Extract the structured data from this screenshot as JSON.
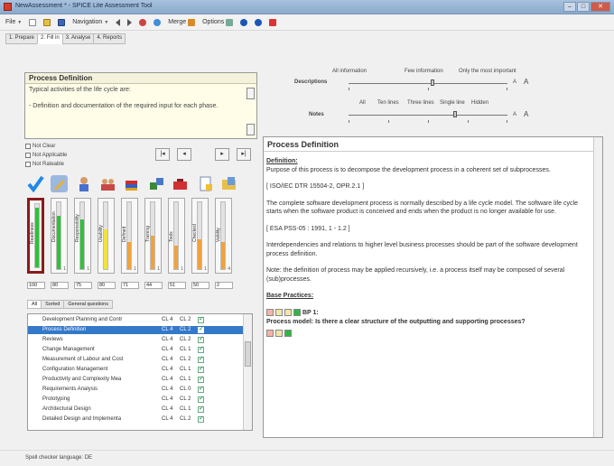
{
  "window": {
    "title": "NewAssessment * - SPICE Lite Assessment Tool",
    "min": "–",
    "max": "□",
    "close": "✕"
  },
  "menu": {
    "file": "File",
    "navigation": "Navigation",
    "merge": "Merge",
    "options": "Options"
  },
  "tabs": [
    "1. Prepare",
    "2. Fill in",
    "3. Analyse",
    "4. Reports"
  ],
  "active_tab": 1,
  "process_header": {
    "title": "Process Definition",
    "text": "Typical activities of the life cycle are:\n\n- Definition and documentation of the required input for each phase."
  },
  "descriptions": {
    "label": "Descriptions",
    "options": [
      "All information",
      "Few information",
      "Only the most important"
    ],
    "font_small": "A",
    "font_big": "A"
  },
  "notes": {
    "label": "Notes",
    "options": [
      "All",
      "Ten lines",
      "Three lines",
      "Single line",
      "Hidden"
    ],
    "font_small": "A",
    "font_big": "A"
  },
  "checkboxes": [
    "Not Clear",
    "Not Applicable",
    "Not Rateable"
  ],
  "nav_buttons": {
    "first": "|◂",
    "prev": "◂",
    "next": "▸",
    "last": "▸|"
  },
  "icons": [
    "check-icon",
    "pencil-icon",
    "person-icon",
    "team-icon",
    "books-icon",
    "tools-icon",
    "toolbox-icon",
    "document-icon",
    "folder-icon"
  ],
  "gauges": [
    {
      "label": "Readiness",
      "fill": 0.95,
      "color": "#2fc23a",
      "num": ""
    },
    {
      "label": "Documentation",
      "fill": 0.8,
      "color": "#2fc23a",
      "num": "1"
    },
    {
      "label": "Responsibility",
      "fill": 0.75,
      "color": "#2fc23a",
      "num": "1"
    },
    {
      "label": "Usability",
      "fill": 0.6,
      "color": "#f2e23a",
      "num": ""
    },
    {
      "label": "Defined",
      "fill": 0.4,
      "color": "#f2a23a",
      "num": "1"
    },
    {
      "label": "Training",
      "fill": 0.5,
      "color": "#f2a23a",
      "num": "1"
    },
    {
      "label": "Tools",
      "fill": 0.35,
      "color": "#f2a23a",
      "num": "1"
    },
    {
      "label": "Checked",
      "fill": 0.45,
      "color": "#f2a23a",
      "num": "1"
    },
    {
      "label": "Validity",
      "fill": 0.4,
      "color": "#f2a23a",
      "num": "4"
    }
  ],
  "percents": [
    "100",
    "80",
    "75",
    "80",
    "71",
    "44",
    "51",
    "50",
    "2"
  ],
  "subtabs": [
    "All",
    "Sorted",
    "General questions"
  ],
  "tree": [
    {
      "name": "Development Planning and Contr",
      "cl": "CL 4",
      "ol": "CL 2",
      "sel": false
    },
    {
      "name": "Process Definition",
      "cl": "CL 4",
      "ol": "CL 2",
      "sel": true
    },
    {
      "name": "Reviews",
      "cl": "CL 4",
      "ol": "CL 2",
      "sel": false
    },
    {
      "name": "Change Management",
      "cl": "CL 4",
      "ol": "CL 1",
      "sel": false
    },
    {
      "name": "Measurement of Labour and Cost",
      "cl": "CL 4",
      "ol": "CL 2",
      "sel": false
    },
    {
      "name": "Configuration Management",
      "cl": "CL 4",
      "ol": "CL 1",
      "sel": false
    },
    {
      "name": "Productivity and Complexity Mea",
      "cl": "CL 4",
      "ol": "CL 1",
      "sel": false
    },
    {
      "name": "Requirements Analysis",
      "cl": "CL 4",
      "ol": "CL 0",
      "sel": false
    },
    {
      "name": "Prototyping",
      "cl": "CL 4",
      "ol": "CL 2",
      "sel": false
    },
    {
      "name": "Architectural Design",
      "cl": "CL 4",
      "ol": "CL 1",
      "sel": false
    },
    {
      "name": "Detailed Design and Implementa",
      "cl": "CL 4",
      "ol": "CL 2",
      "sel": false
    }
  ],
  "content": {
    "title": "Process Definition",
    "definition_label": "Definition:",
    "p1": "Purpose of this process is to decompose the development process in a coherent set of subprocesses.",
    "p2": "[ ISO/IEC DTR 15504-2, OPR.2.1 ]",
    "p3": "The complete software development process is normally described by a life cycle model. The software life cycle starts when the software product is conceived and ends when the product is no longer available for use.",
    "p4": "[ ESA PSS-05 : 1991, 1 - 1.2 ]",
    "p5": "Interdependencies and relations to higher level business processes should be part of the software development process definition.",
    "p6": "Note: the definition of process may be applied recursively, i.e. a process itself may be composed of several (sub)processes.",
    "bp_label": "Base Practices:",
    "bp1_id": "BP 1:",
    "bp1_text": "Process model: Is there a clear structure of the outputting and supporting processes?"
  },
  "status": {
    "spell_label": "Spell checker language:",
    "spell_value": "DE"
  }
}
